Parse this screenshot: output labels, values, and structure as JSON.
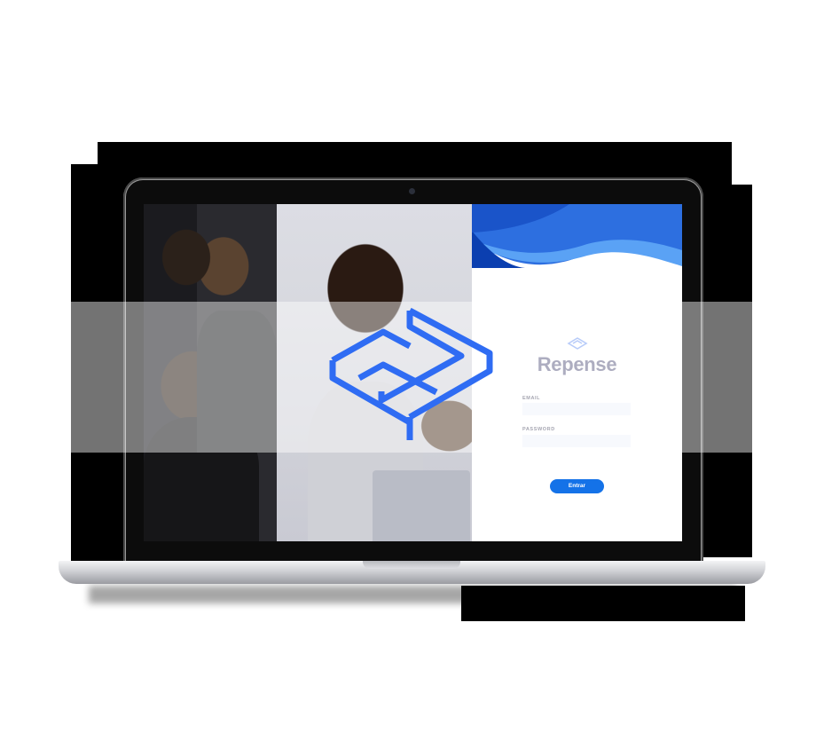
{
  "brand": {
    "name": "Repense"
  },
  "form": {
    "email_label": "EMAIL",
    "email_value": "",
    "password_label": "PASSWORD",
    "password_value": "",
    "submit_label": "Entrar"
  },
  "colors": {
    "accent": "#1472e8",
    "logo_blue": "#2f6cf3",
    "brand_text": "#6b6b8c",
    "wave_dark": "#0b3fb0",
    "wave_mid": "#2d6fe0",
    "wave_light": "#5aa2f5"
  },
  "icons": {
    "logo": "repense-box-logo-icon"
  }
}
